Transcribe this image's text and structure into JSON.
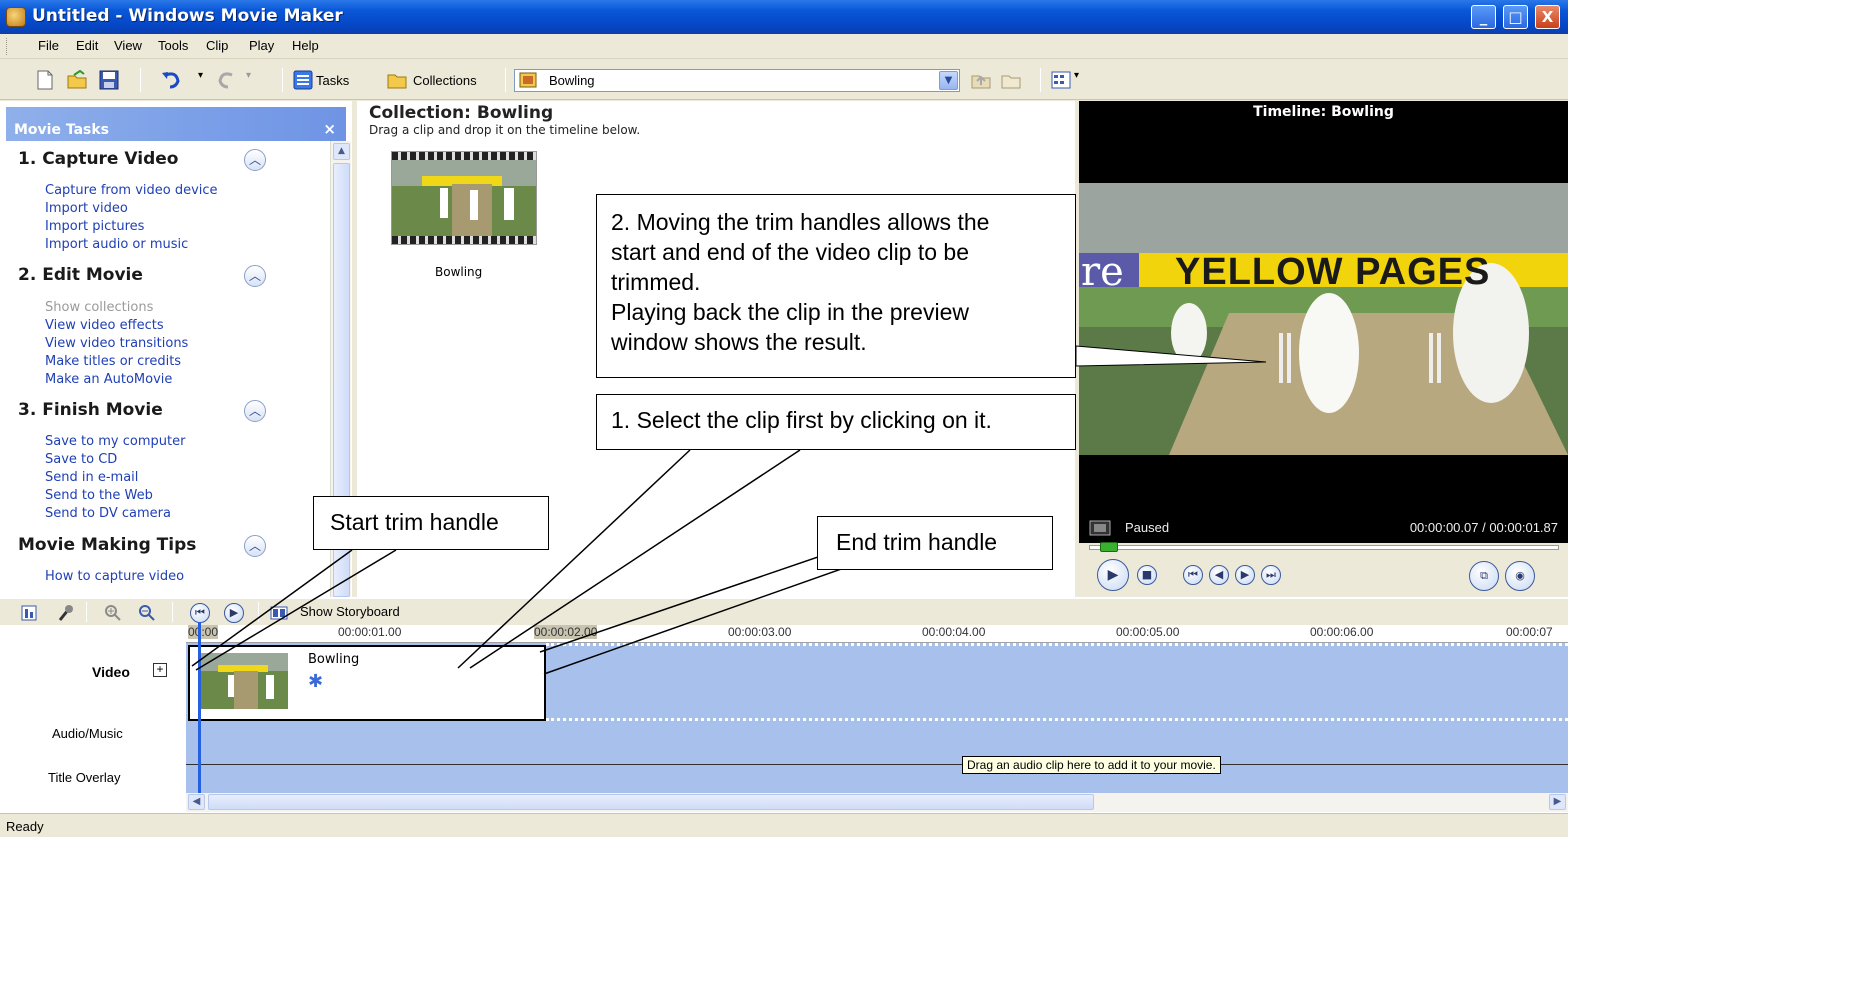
{
  "window": {
    "title": "Untitled - Windows Movie Maker",
    "controls": {
      "minimize": "_",
      "maximize": "□",
      "close": "X"
    }
  },
  "menu": [
    "File",
    "Edit",
    "View",
    "Tools",
    "Clip",
    "Play",
    "Help"
  ],
  "toolbar": {
    "tasks_label": "Tasks",
    "collections_label": "Collections",
    "collection_value": "Bowling",
    "icons": [
      "new-project-icon",
      "open-project-icon",
      "save-project-icon",
      "undo-icon",
      "redo-icon",
      "up-one-level-icon",
      "new-collection-folder-icon",
      "views-icon"
    ]
  },
  "task_pane": {
    "title": "Movie Tasks",
    "close": "×",
    "sections": [
      {
        "title": "1. Capture Video",
        "links": [
          "Capture from video device",
          "Import video",
          "Import pictures",
          "Import audio or music"
        ]
      },
      {
        "title": "2. Edit Movie",
        "links": [
          "Show collections",
          "View video effects",
          "View video transitions",
          "Make titles or credits",
          "Make an AutoMovie"
        ]
      },
      {
        "title": "3. Finish Movie",
        "links": [
          "Save to my computer",
          "Save to CD",
          "Send in e-mail",
          "Send to the Web",
          "Send to DV camera"
        ]
      },
      {
        "title": "Movie Making Tips",
        "links": [
          "How to capture video"
        ]
      }
    ],
    "disabled_link": "Show collections"
  },
  "collection": {
    "title": "Collection: Bowling",
    "subtitle": "Drag a clip and drop it on the timeline below.",
    "clip_name": "Bowling"
  },
  "preview": {
    "title": "Timeline: Bowling",
    "status": "Paused",
    "time": "00:00:00.07 / 00:00:01.87",
    "video_banner": "YELLOW PAGES",
    "video_banner_prefix": "re"
  },
  "timeline_toolbar": {
    "storyboard_label": "Show Storyboard"
  },
  "timeline": {
    "ruler": [
      "00:00",
      "00:00:01.00",
      "00:00:02.00",
      "00:00:03.00",
      "00:00:04.00",
      "00:00:05.00",
      "00:00:06.00",
      "00:00:07"
    ],
    "tracks": {
      "video": "Video",
      "audio": "Audio/Music",
      "title": "Title Overlay"
    },
    "clip_name": "Bowling",
    "tooltip": "Drag an audio clip here to add it to your movie."
  },
  "status_bar": "Ready",
  "callouts": {
    "trim_lines": [
      "2. Moving the trim handles allows the",
      "start and end of the video clip to be",
      "trimmed.",
      "Playing back the clip in the preview",
      "window shows the result."
    ],
    "select": "1. Select the clip first by clicking on it.",
    "start": "Start trim handle",
    "end": "End trim handle"
  },
  "colors": {
    "titlebar": "#0548c8",
    "task_link": "#1f3fb4",
    "timeline_track": "#a7c0ec",
    "playhead": "#2560e0"
  }
}
